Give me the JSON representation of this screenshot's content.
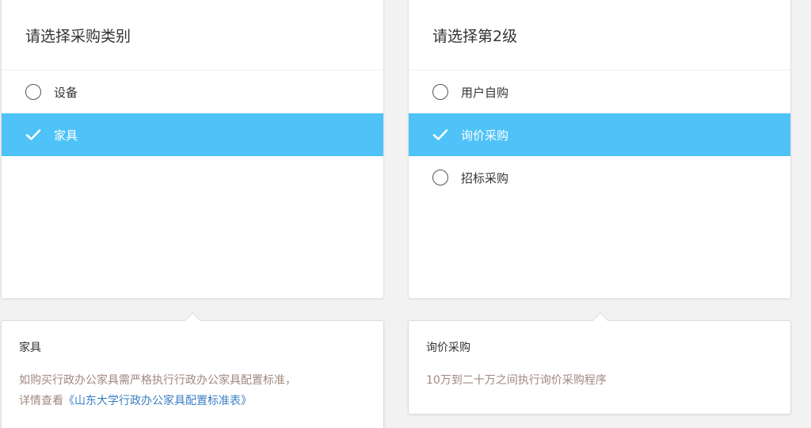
{
  "left_panel": {
    "title": "请选择采购类别",
    "options": [
      {
        "label": "设备",
        "selected": false
      },
      {
        "label": "家具",
        "selected": true
      }
    ]
  },
  "right_panel": {
    "title": "请选择第2级",
    "options": [
      {
        "label": "用户自购",
        "selected": false
      },
      {
        "label": "询价采购",
        "selected": true
      },
      {
        "label": "招标采购",
        "selected": false
      }
    ]
  },
  "left_desc": {
    "title": "家具",
    "line1": "如购买行政办公家具需严格执行行政办公家具配置标准，",
    "line2_prefix": "详情查看",
    "link": "《山东大学行政办公家具配置标准表》"
  },
  "right_desc": {
    "title": "询价采购",
    "text": "10万到二十万之间执行询价采购程序"
  },
  "colors": {
    "selected_bg": "#4fc3f7",
    "desc_text": "#a1887f",
    "link": "#3a7fc4"
  },
  "icons": {
    "selected": "check-icon",
    "unselected": "radio-circle"
  }
}
